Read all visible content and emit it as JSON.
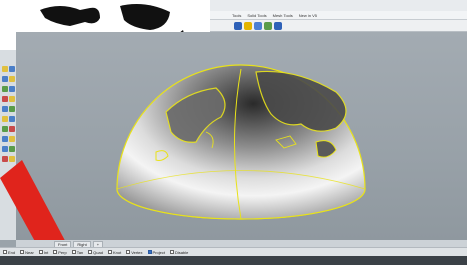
{
  "menubar": {
    "items": [
      "Tools",
      "Solid Tools",
      "Mesh Tools",
      "New in V5"
    ]
  },
  "viewport_tabs": [
    "Front",
    "Right"
  ],
  "osnap": {
    "items": [
      {
        "label": "End",
        "checked": false
      },
      {
        "label": "Near",
        "checked": false
      },
      {
        "label": "Int",
        "checked": false
      },
      {
        "label": "Perp",
        "checked": false
      },
      {
        "label": "Tan",
        "checked": false
      },
      {
        "label": "Quad",
        "checked": false
      },
      {
        "label": "Knot",
        "checked": false
      },
      {
        "label": "Vertex",
        "checked": false
      },
      {
        "label": "Project",
        "checked": true
      },
      {
        "label": "Disable",
        "checked": false
      }
    ]
  },
  "colors": {
    "wireframe": "#e8e21a",
    "accent_red": "#e0241c",
    "thumbnail_border": "#2f8a3a"
  }
}
